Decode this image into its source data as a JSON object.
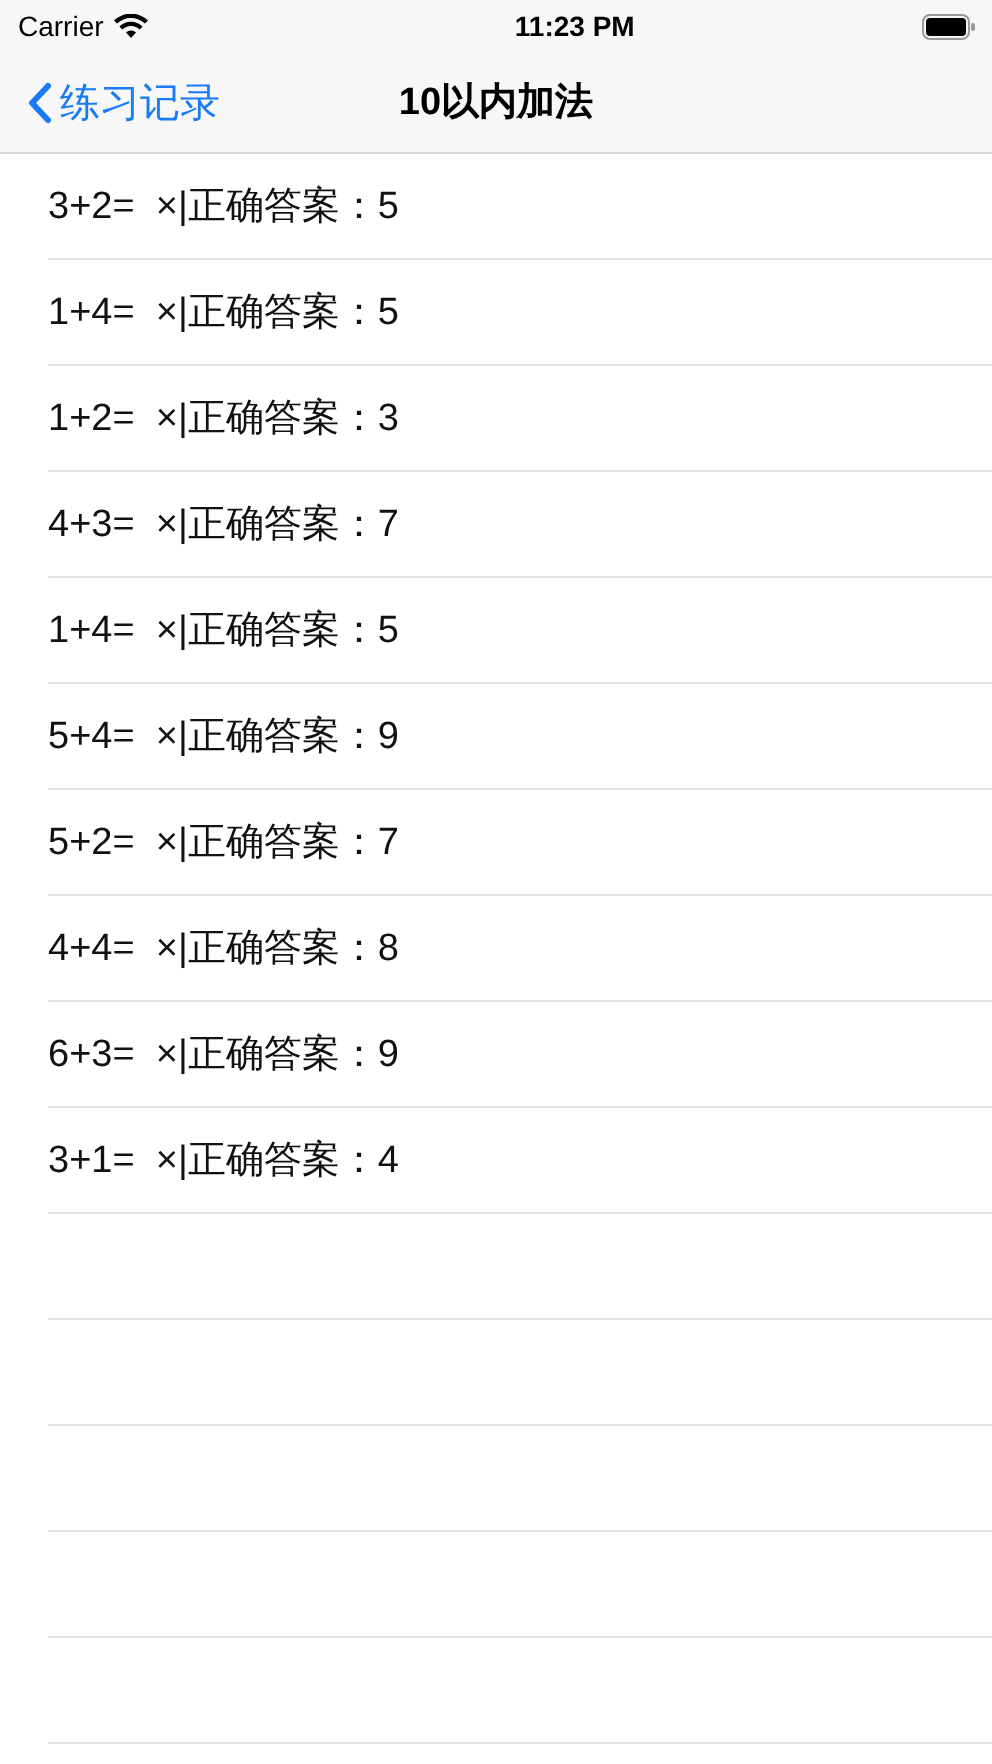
{
  "status_bar": {
    "carrier": "Carrier",
    "time": "11:23 PM"
  },
  "nav": {
    "back": "练习记录",
    "title": "10以内加法"
  },
  "records": [
    {
      "text": "3+2=  ×|正确答案：5"
    },
    {
      "text": "1+4=  ×|正确答案：5"
    },
    {
      "text": "1+2=  ×|正确答案：3"
    },
    {
      "text": "4+3=  ×|正确答案：7"
    },
    {
      "text": "1+4=  ×|正确答案：5"
    },
    {
      "text": "5+4=  ×|正确答案：9"
    },
    {
      "text": "5+2=  ×|正确答案：7"
    },
    {
      "text": "4+4=  ×|正确答案：8"
    },
    {
      "text": "6+3=  ×|正确答案：9"
    },
    {
      "text": "3+1=  ×|正确答案：4"
    }
  ]
}
